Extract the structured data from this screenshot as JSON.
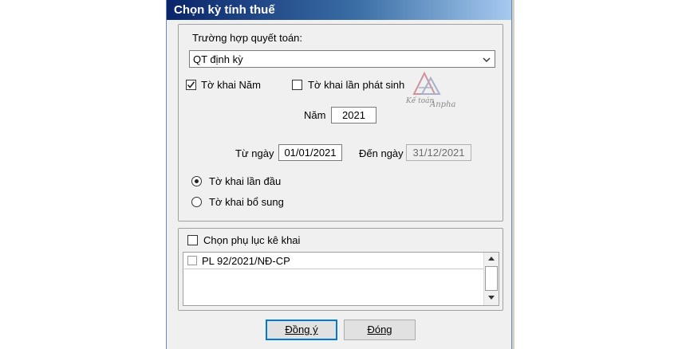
{
  "window": {
    "title": "Chọn kỳ tính thuế"
  },
  "settlement": {
    "label": "Trường hợp quyết toán:",
    "selected": "QT định kỳ"
  },
  "period_type": {
    "year_label": "Tờ khai Năm",
    "year_checked": true,
    "occurrence_label": "Tờ khai lần phát sinh",
    "occurrence_checked": false
  },
  "year": {
    "label": "Năm",
    "value": "2021"
  },
  "dates": {
    "from_label": "Từ ngày",
    "from_value": "01/01/2021",
    "to_label": "Đến ngày",
    "to_value": "31/12/2021"
  },
  "declaration": {
    "first_label": "Tờ khai lần đầu",
    "first_selected": true,
    "supplement_label": "Tờ khai bổ sung",
    "supplement_selected": false
  },
  "appendix": {
    "label": "Chọn phụ lục kê khai",
    "checked": false,
    "items": [
      {
        "label": "PL 92/2021/NĐ-CP",
        "checked": false
      }
    ]
  },
  "watermark": {
    "line1": "Kế toán",
    "line2": "Anpha"
  },
  "buttons": {
    "ok": "Đồng ý",
    "close": "Đóng"
  },
  "icons": {
    "dropdown": "chevron-down-icon",
    "check": "checkmark-icon",
    "scroll_up": "scroll-up-arrow-icon",
    "scroll_down": "scroll-down-arrow-icon",
    "logo": "anpha-logo-icon"
  }
}
